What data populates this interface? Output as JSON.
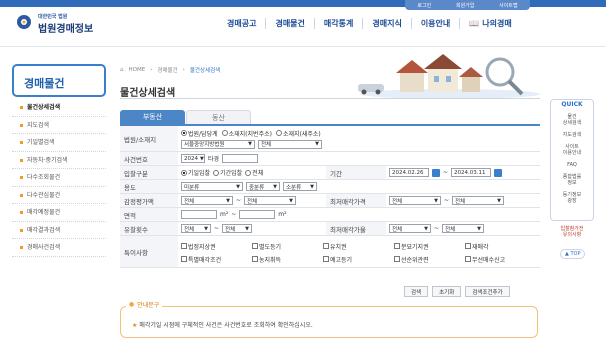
{
  "header": {
    "logo_small": "대한민국 법원",
    "logo_main": "법원경매정보",
    "top_links": [
      "로그인",
      "회원가입",
      "사이트맵"
    ],
    "gnb": [
      "경매공고",
      "경매물건",
      "매각통계",
      "경매지식",
      "이용안내"
    ],
    "mypage": "나의경매"
  },
  "sidebar": {
    "title": "경매물건",
    "items": [
      "물건상세검색",
      "지도검색",
      "기일별검색",
      "자동차·중기검색",
      "다수조회물건",
      "다수관심물건",
      "매각예정물건",
      "매각결과검색",
      "경매사건검색"
    ],
    "active_index": 0
  },
  "breadcrumb": [
    "HOME",
    "경매물건",
    "물건상세검색"
  ],
  "page_title": "물건상세검색",
  "tabs": [
    "부동산",
    "동산"
  ],
  "form": {
    "court_label": "법원/소재지",
    "court_radios": [
      "법원/담당계",
      "소재지(지번주소)",
      "소재지(새주소)"
    ],
    "court_select": "서울중앙지방법원",
    "court_select2": "전체",
    "case_label": "사건번호",
    "case_year": "2024",
    "case_suffix": "타경",
    "bid_label": "입찰구분",
    "bid_radios": [
      "기일입찰",
      "기간입찰",
      "전체"
    ],
    "period_label": "기간",
    "date_from": "2024.02.26",
    "date_to": "2024.03.11",
    "use_label": "용도",
    "use_select1": "미분류",
    "use_select2": "중분류",
    "use_select3": "소분류",
    "appraisal_label": "감정평가액",
    "lowest_label": "최저매각가격",
    "all": "전체",
    "area_label": "면적",
    "unit": "m²",
    "fail_label": "유찰횟수",
    "lowest_rate_label": "최저매각가율",
    "special_label": "특이사항",
    "special_items": [
      "법정지상권",
      "별도등기",
      "유치권",
      "분묘기지권",
      "재매각",
      "특별매각조건",
      "농지취득",
      "예고등기",
      "선순위관련",
      "무선매수신고"
    ],
    "tilde": "~"
  },
  "buttons": [
    "검색",
    "초기화",
    "검색조건추가"
  ],
  "notice": {
    "title": "안내문구",
    "text": "매각기일 시점에 구체적인 사건은 사건번호로 조회하여 확인하십시오."
  },
  "quick": {
    "title": "QUICK",
    "items": [
      "물건\n상세검색",
      "지도검색",
      "사이트\n이용안내",
      "FAQ",
      "종합법률\n정보",
      "등기정보\n광장"
    ],
    "extra": "입찰참가전\n유의사항",
    "top": "TOP"
  },
  "colors": {
    "accent": "#2f6bb8",
    "tab_active": "#4d86c7",
    "notice_border": "#f0c27a"
  }
}
